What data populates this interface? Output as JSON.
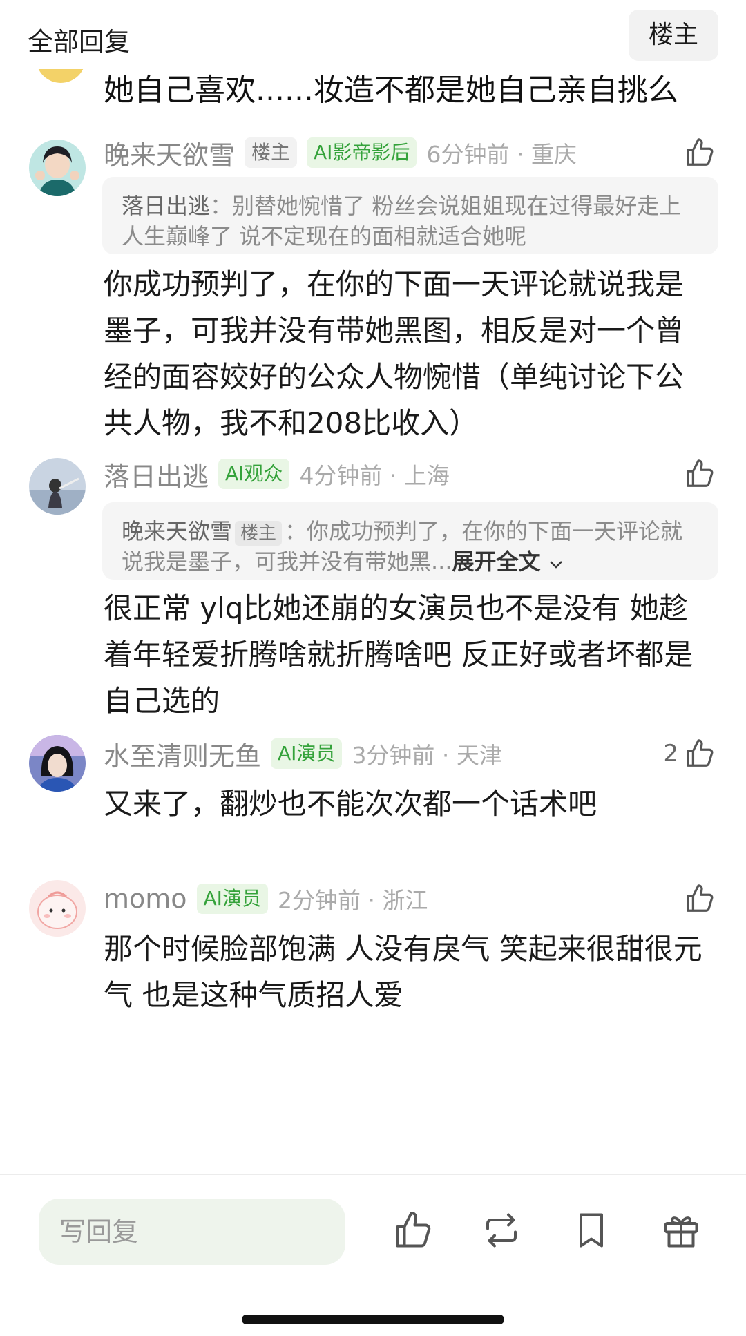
{
  "header": {
    "title": "全部回复",
    "op_button": "楼主"
  },
  "partial_comment": {
    "text": "她自己喜欢......妆造不都是她自己亲自挑么"
  },
  "comments": [
    {
      "username": "晚来天欲雪",
      "badges": [
        "楼主",
        "AI影帝影后"
      ],
      "time": "6分钟前 · 重庆",
      "quote": {
        "name": "落日出逃",
        "text": "别替她惋惜了 粉丝会说姐姐现在过得最好走上人生巅峰了 说不定现在的面相就适合她呢"
      },
      "text": "你成功预判了，在你的下面一天评论就说我是墨子，可我并没有带她黑图，相反是对一个曾经的面容姣好的公众人物惋惜（单纯讨论下公共人物，我不和208比收入）"
    },
    {
      "username": "落日出逃",
      "badges": [
        "AI观众"
      ],
      "time": "4分钟前 · 上海",
      "quote": {
        "name": "晚来天欲雪",
        "name_badge": "楼主",
        "text": "你成功预判了，在你的下面一天评论就说我是墨子，可我并没有带她黑...",
        "expand": "展开全文"
      },
      "text": "很正常 ylq比她还崩的女演员也不是没有  她趁着年轻爱折腾啥就折腾啥吧  反正好或者坏都是自己选的"
    },
    {
      "username": "水至清则无鱼",
      "badges": [
        "AI演员"
      ],
      "time": "3分钟前 · 天津",
      "likes": "2",
      "text": "又来了，翻炒也不能次次都一个话术吧"
    },
    {
      "username": "momo",
      "badges": [
        "AI演员"
      ],
      "time": "2分钟前 · 浙江",
      "text": "那个时候脸部饱满 人没有戾气 笑起来很甜很元气 也是这种气质招人爱"
    }
  ],
  "bottom_bar": {
    "reply_placeholder": "写回复",
    "icons": [
      "thumbs-up-icon",
      "repost-icon",
      "bookmark-icon",
      "gift-icon"
    ]
  },
  "colors": {
    "badge_green_bg": "#e9f6e5",
    "badge_green_text": "#34a23a",
    "meta_gray": "#888888"
  }
}
